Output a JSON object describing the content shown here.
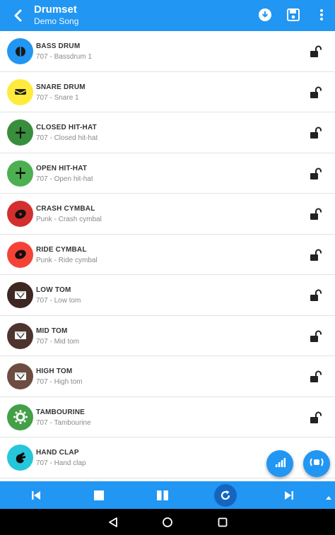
{
  "header": {
    "title": "Drumset",
    "subtitle": "Demo Song",
    "icons": [
      "back-arrow-icon",
      "download-icon",
      "save-icon",
      "more-vert-icon"
    ]
  },
  "instruments": [
    {
      "name": "BASS DRUM",
      "sub": "707 - Bassdrum 1",
      "color": "#2196F3",
      "icon": "bass-drum-icon"
    },
    {
      "name": "SNARE DRUM",
      "sub": "707 - Snare 1",
      "color": "#FFEB3B",
      "icon": "snare-drum-icon"
    },
    {
      "name": "CLOSED HIT-HAT",
      "sub": "707 - Closed hit-hat",
      "color": "#388E3C",
      "icon": "hihat-icon"
    },
    {
      "name": "OPEN HIT-HAT",
      "sub": "707 - Open hit-hat",
      "color": "#4CAF50",
      "icon": "hihat-icon"
    },
    {
      "name": "CRASH CYMBAL",
      "sub": "Punk - Crash cymbal",
      "color": "#D32F2F",
      "icon": "cymbal-icon"
    },
    {
      "name": "RIDE CYMBAL",
      "sub": "Punk - Ride cymbal",
      "color": "#F44336",
      "icon": "cymbal-icon"
    },
    {
      "name": "LOW TOM",
      "sub": "707 - Low tom",
      "color": "#3E2723",
      "icon": "tom-icon"
    },
    {
      "name": "MID TOM",
      "sub": "707 - Mid tom",
      "color": "#4E342E",
      "icon": "tom-icon"
    },
    {
      "name": "HIGH TOM",
      "sub": "707 - High tom",
      "color": "#6D4C41",
      "icon": "tom-icon"
    },
    {
      "name": "TAMBOURINE",
      "sub": "707 - Tambourine",
      "color": "#43A047",
      "icon": "tambourine-icon"
    },
    {
      "name": "HAND CLAP",
      "sub": "707 - Hand clap",
      "color": "#26C6DA",
      "icon": "hand-clap-icon"
    }
  ],
  "colors": {
    "primary": "#2196F3",
    "primary_dark": "#1565C0",
    "nav_bar": "#000000"
  },
  "fabs": [
    "volume-bars-icon",
    "speaker-icon"
  ],
  "transport": [
    "skip-previous-icon",
    "stop-icon",
    "pause-icon",
    "loop-icon",
    "skip-next-icon",
    "expand-up-icon"
  ],
  "system_nav": [
    "nav-back-icon",
    "nav-home-icon",
    "nav-recents-icon"
  ]
}
